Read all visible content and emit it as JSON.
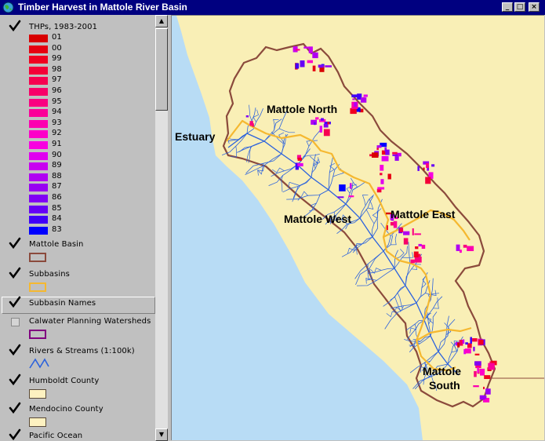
{
  "window": {
    "title": "Timber Harvest in Mattole River Basin",
    "controls": {
      "minimize": "_",
      "maximize": "□",
      "close": "×"
    }
  },
  "legend": {
    "thp": {
      "title": "THPs, 1983-2001",
      "checked": true,
      "classes": [
        {
          "label": "01",
          "color": "#d80000"
        },
        {
          "label": "00",
          "color": "#e60010"
        },
        {
          "label": "99",
          "color": "#f00020"
        },
        {
          "label": "98",
          "color": "#f40038"
        },
        {
          "label": "97",
          "color": "#f70050"
        },
        {
          "label": "96",
          "color": "#f80068"
        },
        {
          "label": "95",
          "color": "#fa0080"
        },
        {
          "label": "94",
          "color": "#fb0098"
        },
        {
          "label": "93",
          "color": "#fc00b0"
        },
        {
          "label": "92",
          "color": "#fd00c8"
        },
        {
          "label": "91",
          "color": "#f800e0"
        },
        {
          "label": "90",
          "color": "#e000f0"
        },
        {
          "label": "89",
          "color": "#c800f0"
        },
        {
          "label": "88",
          "color": "#b000f2"
        },
        {
          "label": "87",
          "color": "#9800f2"
        },
        {
          "label": "86",
          "color": "#8000f4"
        },
        {
          "label": "85",
          "color": "#6600f6"
        },
        {
          "label": "84",
          "color": "#4000f8"
        },
        {
          "label": "83",
          "color": "#0000ff"
        }
      ]
    },
    "layers": [
      {
        "name": "Mattole Basin",
        "checked": true,
        "symbol": "box",
        "color": "#8b4a3c"
      },
      {
        "name": "Subbasins",
        "checked": true,
        "symbol": "box",
        "color": "#f5b830"
      },
      {
        "name": "Subbasin Names",
        "checked": true,
        "symbol": "none",
        "selected": true
      },
      {
        "name": "Calwater Planning Watersheds",
        "checked": false,
        "symbol": "box",
        "color": "#800080"
      },
      {
        "name": "Rivers & Streams (1:100k)",
        "checked": true,
        "symbol": "line",
        "color": "#2b62dd"
      },
      {
        "name": "Humboldt County",
        "checked": true,
        "symbol": "fill",
        "color": "#fdf1c0"
      },
      {
        "name": "Mendocino County",
        "checked": true,
        "symbol": "fill",
        "color": "#fdf1c0"
      },
      {
        "name": "Pacific Ocean",
        "checked": true,
        "symbol": "fill",
        "color": "#b8dcf5"
      }
    ]
  },
  "map": {
    "colors": {
      "land": "#f9efb6",
      "ocean": "#b8dcf5",
      "basin_outline": "#8b4a3c",
      "subbasin_outline": "#f5b830",
      "streams": "#2b62dd"
    },
    "labels": {
      "estuary": "Estuary",
      "north": "Mattole North",
      "west": "Mattole West",
      "east": "Mattole East",
      "south_line1": "Mattole",
      "south_line2": "South"
    }
  }
}
